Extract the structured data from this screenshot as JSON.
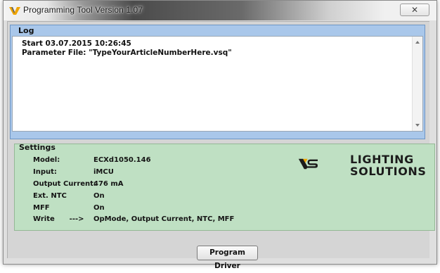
{
  "window": {
    "title": "Programming Tool Version 1.07",
    "close_glyph": "✕"
  },
  "log": {
    "label": "Log",
    "lines": [
      "Start 03.07.2015 10:26:45",
      "Parameter File:  \"TypeYourArticleNumberHere.vsq\""
    ]
  },
  "settings": {
    "label": "Settings",
    "rows": [
      {
        "label": "Model:",
        "value": "ECXd1050.146"
      },
      {
        "label": "Input:",
        "value": "iMCU"
      },
      {
        "label": "Output Current:",
        "value": "476 mA"
      },
      {
        "label": "Ext. NTC",
        "value": "On"
      },
      {
        "label": "MFF",
        "value": "On"
      },
      {
        "label": "Write      --->",
        "value": "OpMode, Output Current, NTC, MFF"
      }
    ]
  },
  "logo": {
    "line1": "LIGHTING",
    "line2": "SOLUTIONS",
    "colors": {
      "accent": "#f0a500",
      "dark": "#1b1b1b"
    }
  },
  "actions": {
    "program_driver_label": "Program Driver"
  },
  "colors": {
    "log_frame": "#a9c7ea",
    "settings_panel": "#bfe0c3",
    "window_bg": "#dfdfdf"
  }
}
